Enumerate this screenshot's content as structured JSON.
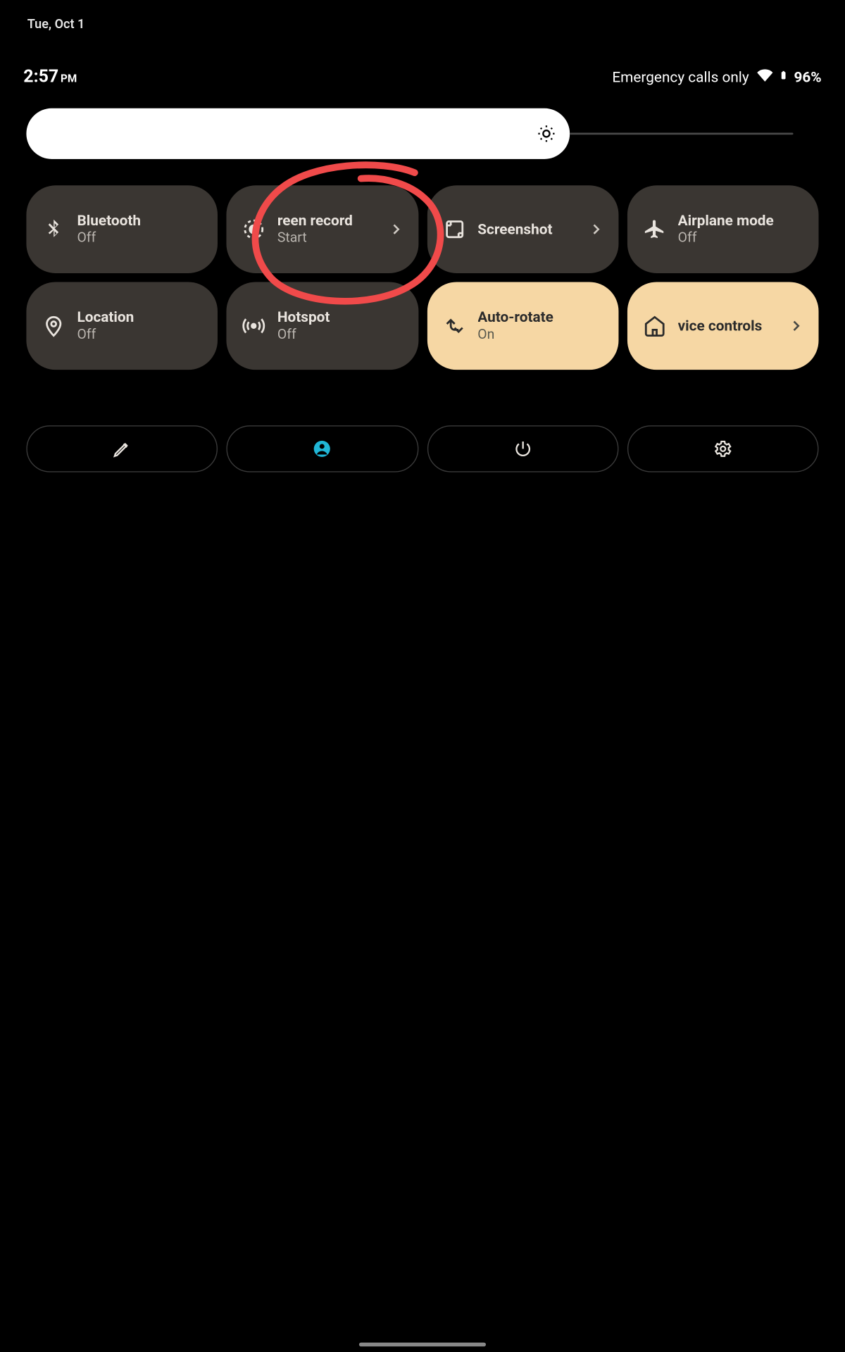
{
  "date": "Tue, Oct 1",
  "time": {
    "value": "2:57",
    "ampm": "PM"
  },
  "status": {
    "emergency": "Emergency calls only",
    "battery": "96%"
  },
  "brightness": {
    "percent": 68
  },
  "tiles": [
    {
      "id": "bluetooth",
      "title": "Bluetooth",
      "sub": "Off",
      "active": false,
      "chevron": false
    },
    {
      "id": "screenrecord",
      "title": "reen record",
      "sub": "Start",
      "active": false,
      "chevron": true
    },
    {
      "id": "screenshot",
      "title": "Screenshot",
      "sub": "",
      "active": false,
      "chevron": true
    },
    {
      "id": "airplane",
      "title": "Airplane mode",
      "sub": "Off",
      "active": false,
      "chevron": false
    },
    {
      "id": "location",
      "title": "Location",
      "sub": "Off",
      "active": false,
      "chevron": false
    },
    {
      "id": "hotspot",
      "title": "Hotspot",
      "sub": "Off",
      "active": false,
      "chevron": false
    },
    {
      "id": "autorotate",
      "title": "Auto-rotate",
      "sub": "On",
      "active": true,
      "chevron": false
    },
    {
      "id": "devicecontrols",
      "title": "vice controls",
      "sub": "",
      "active": true,
      "chevron": true
    }
  ],
  "colors": {
    "tile_bg": "#3a3632",
    "tile_active": "#f6d7a4",
    "annotation": "#f04a4a"
  }
}
